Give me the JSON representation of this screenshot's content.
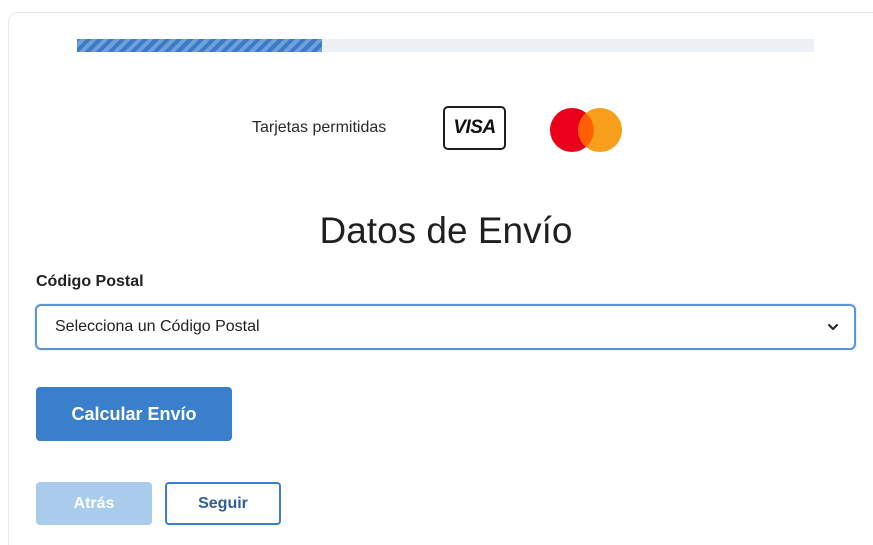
{
  "progress": {
    "fraction": 0.333
  },
  "payment_cards": {
    "label": "Tarjetas permitidas",
    "brands": [
      {
        "name": "VISA",
        "icon": "visa-logo"
      },
      {
        "name": "Mastercard",
        "icon": "mastercard-logo"
      }
    ]
  },
  "form": {
    "title": "Datos de Envío",
    "postal_code": {
      "label": "Código Postal",
      "selected": "Selecciona un Código Postal"
    },
    "calculate_button": "Calcular Envío"
  },
  "navigation": {
    "back_label": "Atrás",
    "next_label": "Seguir"
  },
  "colors": {
    "primary": "#3a7fcc",
    "primary_disabled": "#a9cbec",
    "focus_border": "#5b95d6",
    "progress_track": "#edf1f6",
    "mastercard_red": "#eb001b",
    "mastercard_orange": "#f79e1b",
    "mastercard_overlap": "#ff5f00"
  }
}
